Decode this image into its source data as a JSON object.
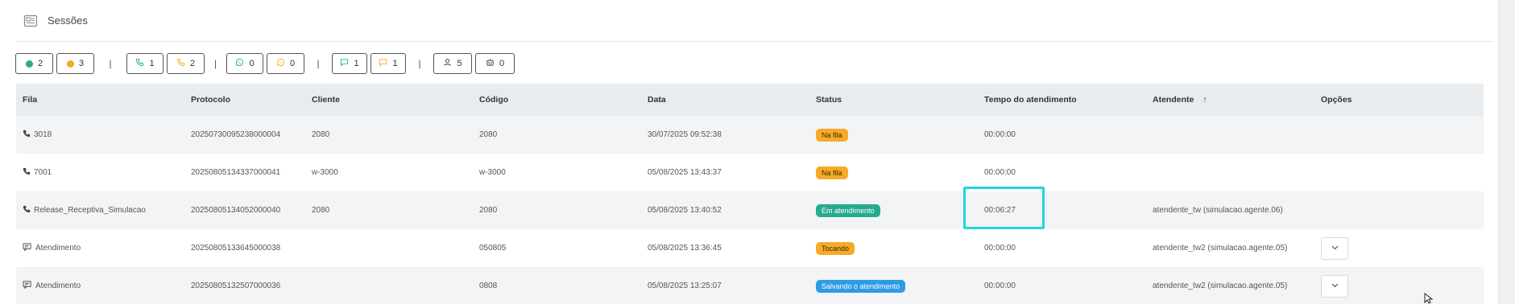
{
  "header": {
    "title": "Sessões",
    "icon": "sessions-icon"
  },
  "counters": [
    {
      "name": "counter-online",
      "icon": "green-dot",
      "color": "#26ac8c",
      "value": "2"
    },
    {
      "name": "counter-paused",
      "icon": "orange-dot",
      "color": "#f7a928",
      "value": "3"
    },
    {
      "name": "counter-calls-active",
      "icon": "phone-icon",
      "color": "#26ac8c",
      "value": "1"
    },
    {
      "name": "counter-calls-waiting",
      "icon": "phone-icon",
      "color": "#f7a928",
      "value": "2"
    },
    {
      "name": "counter-whatsapp-active",
      "icon": "whatsapp-icon",
      "color": "#26ac8c",
      "value": "0"
    },
    {
      "name": "counter-whatsapp-waiting",
      "icon": "whatsapp-icon",
      "color": "#f7a928",
      "value": "0"
    },
    {
      "name": "counter-chat-active",
      "icon": "chat-icon",
      "color": "#26ac8c",
      "value": "1"
    },
    {
      "name": "counter-chat-waiting",
      "icon": "chat-icon",
      "color": "#f7a928",
      "value": "1"
    },
    {
      "name": "counter-agents",
      "icon": "user-icon",
      "color": "#333333",
      "value": "5"
    },
    {
      "name": "counter-bots",
      "icon": "robot-icon",
      "color": "#333333",
      "value": "0"
    }
  ],
  "separator": "|",
  "table": {
    "headers": {
      "fila": "Fila",
      "protocolo": "Protocolo",
      "cliente": "Cliente",
      "codigo": "Código",
      "data": "Data",
      "status": "Status",
      "tempo": "Tempo do atendimento",
      "atendente": "Atendente",
      "atendente_sort": "↑",
      "opcoes": "Opções"
    },
    "rows": [
      {
        "fila_icon": "phone-icon",
        "fila": "3018",
        "protocolo": "20250730095238000004",
        "cliente": "2080",
        "codigo": "2080",
        "data": "30/07/2025 09:52:38",
        "status": "Na fila",
        "status_color": "#f7a928",
        "tempo": "00:00:00",
        "atendente": "",
        "has_options": false
      },
      {
        "fila_icon": "phone-icon",
        "fila": "7001",
        "protocolo": "20250805134337000041",
        "cliente": "w-3000",
        "codigo": "w-3000",
        "data": "05/08/2025 13:43:37",
        "status": "Na fila",
        "status_color": "#f7a928",
        "tempo": "00:00:00",
        "atendente": "",
        "has_options": false
      },
      {
        "fila_icon": "phone-icon",
        "fila": "Release_Receptiva_Simulacao",
        "protocolo": "20250805134052000040",
        "cliente": "2080",
        "codigo": "2080",
        "data": "05/08/2025 13:40:52",
        "status": "Em atendimento",
        "status_color": "#26ac8c",
        "tempo": "00:06:27",
        "atendente": "atendente_tw (simulacao.agente.06)",
        "has_options": false
      },
      {
        "fila_icon": "chat-icon",
        "fila": "Atendimento",
        "protocolo": "20250805133645000038",
        "cliente": "",
        "codigo": "050805",
        "data": "05/08/2025 13:36:45",
        "status": "Tocando",
        "status_color": "#f7a928",
        "tempo": "00:00:00",
        "atendente": "atendente_tw2 (simulacao.agente.05)",
        "has_options": true
      },
      {
        "fila_icon": "chat-icon",
        "fila": "Atendimento",
        "protocolo": "20250805132507000036",
        "cliente": "",
        "codigo": "0808",
        "data": "05/08/2025 13:25:07",
        "status": "Salvando o atendimento",
        "status_color": "#2f9be6",
        "tempo": "00:00:00",
        "atendente": "atendente_tw2 (simulacao.agente.05)",
        "has_options": true
      }
    ]
  }
}
